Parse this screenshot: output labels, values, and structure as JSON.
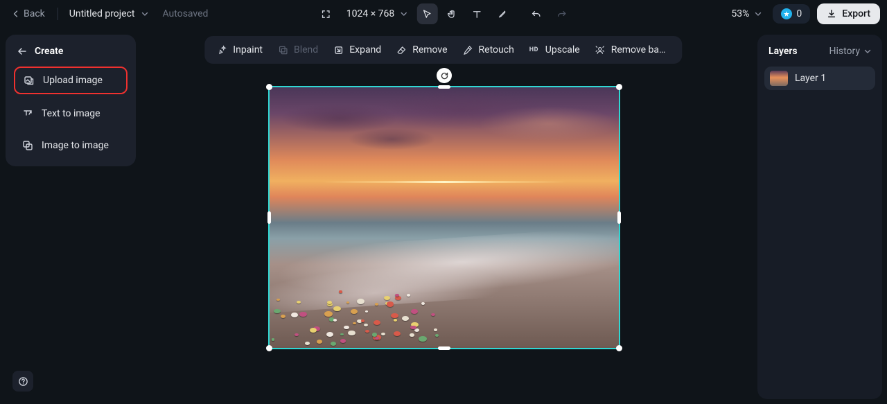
{
  "header": {
    "back_label": "Back",
    "project_name": "Untitled project",
    "autosave_label": "Autosaved",
    "dimensions": "1024 × 768",
    "zoom": "53%",
    "credits": "0",
    "export_label": "Export"
  },
  "sidebar": {
    "title": "Create",
    "items": [
      {
        "label": "Upload image"
      },
      {
        "label": "Text to image"
      },
      {
        "label": "Image to image"
      }
    ]
  },
  "edit_toolbar": {
    "items": [
      {
        "label": "Inpaint",
        "icon": "sparkle-icon",
        "disabled": false
      },
      {
        "label": "Blend",
        "icon": "blend-icon",
        "disabled": true
      },
      {
        "label": "Expand",
        "icon": "expand-icon",
        "disabled": false
      },
      {
        "label": "Remove",
        "icon": "eraser-icon",
        "disabled": false
      },
      {
        "label": "Retouch",
        "icon": "retouch-icon",
        "disabled": false
      },
      {
        "label": "Upscale",
        "icon": "hd-icon",
        "disabled": false
      },
      {
        "label": "Remove back…",
        "icon": "remove-bg-icon",
        "disabled": false
      }
    ]
  },
  "layers_panel": {
    "title": "Layers",
    "history_label": "History",
    "layers": [
      {
        "label": "Layer 1"
      }
    ]
  }
}
